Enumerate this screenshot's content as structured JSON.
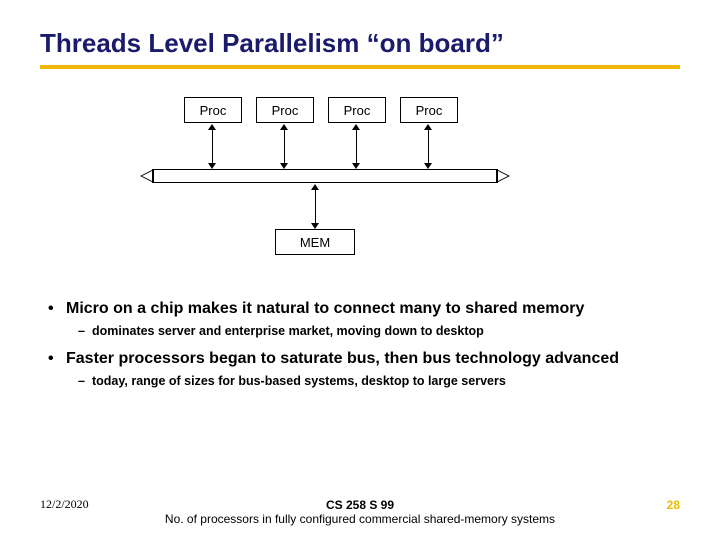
{
  "title": "Threads Level Parallelism “on board”",
  "diagram": {
    "proc_label": "Proc",
    "mem_label": "MEM"
  },
  "bullets": {
    "b1": "Micro on a chip makes it natural to connect many to shared memory",
    "s1": "dominates server and enterprise market, moving down to desktop",
    "b2": "Faster processors began to saturate bus, then bus technology advanced",
    "s2": "today, range of sizes for bus-based systems, desktop to large servers"
  },
  "footer": {
    "date": "12/2/2020",
    "course": "CS 258 S 99",
    "caption": "No. of processors in fully configured commercial shared-memory systems",
    "page": "28"
  }
}
